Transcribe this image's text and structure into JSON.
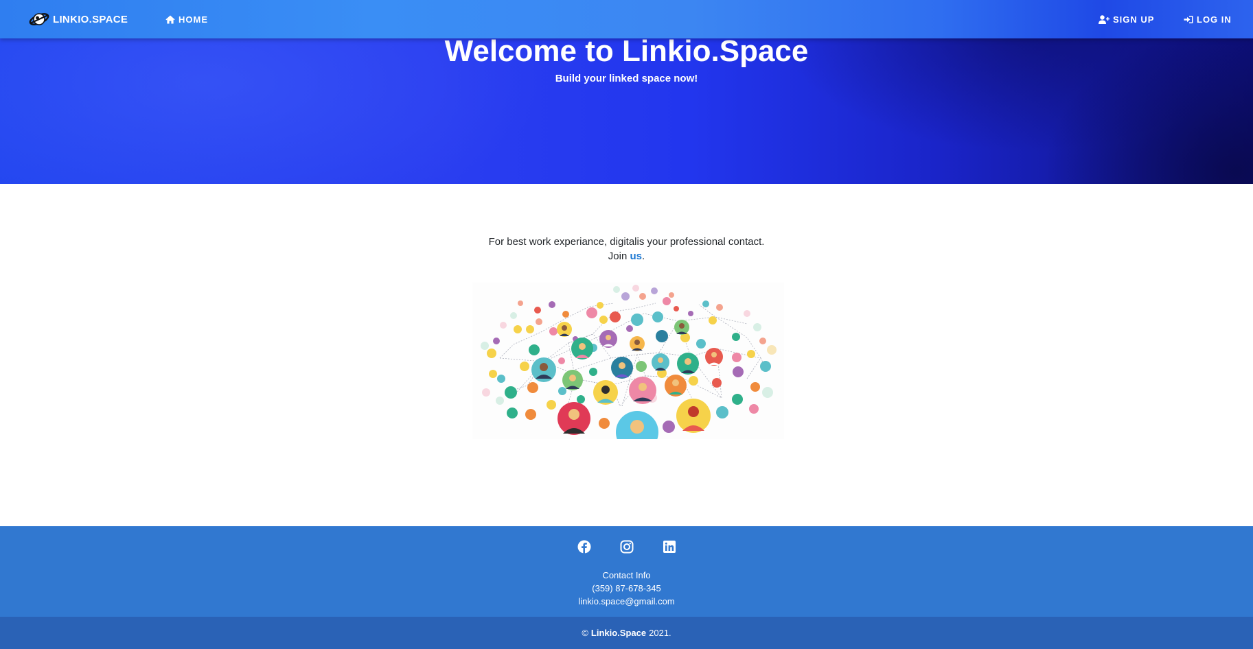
{
  "navbar": {
    "brand": "LINKIO.SPACE",
    "home_label": "HOME",
    "signup_label": "SIGN UP",
    "login_label": "LOG IN"
  },
  "hero": {
    "title": "Welcome to Linkio.Space",
    "subtitle": "Build your linked space now!"
  },
  "intro": {
    "line1": "For best work experiance, digitalis your professional contact.",
    "join_prefix": "Join",
    "join_link": "us",
    "join_suffix": "."
  },
  "footer": {
    "social": [
      "facebook-icon",
      "instagram-icon",
      "linkedin-icon"
    ],
    "contact_title": "Contact Info",
    "phone": "(359) 87-678-345",
    "email": "linkio.space@gmail.com",
    "copyright_symbol": "©",
    "copyright_brand": "Linkio.Space",
    "copyright_year": "2021."
  },
  "colors": {
    "navbar": "#3a8ef5",
    "hero": "#2236ee",
    "footer": "#3178d0",
    "copyright_bar": "#2a62b6",
    "link": "#1976d2"
  }
}
